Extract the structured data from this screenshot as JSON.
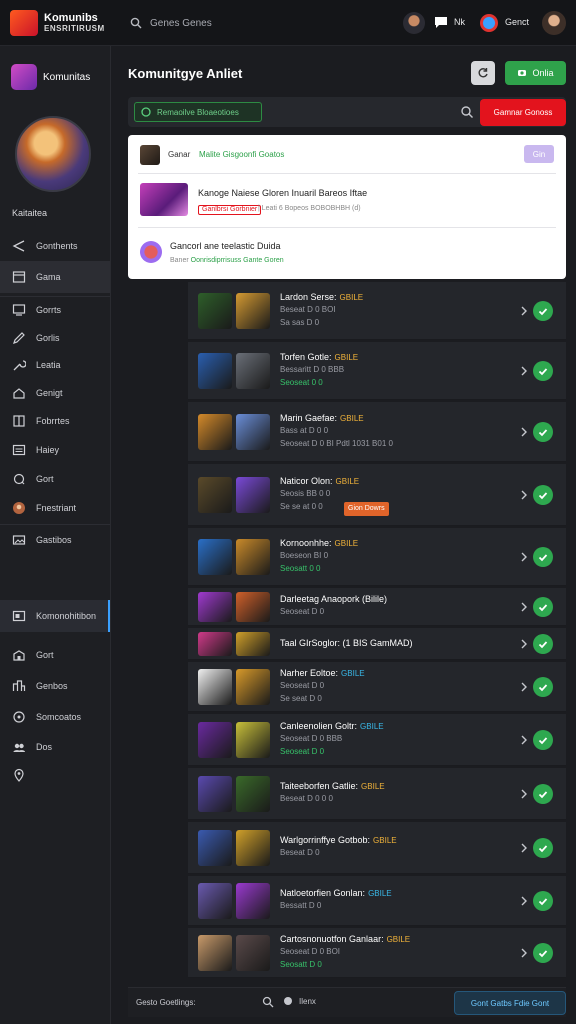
{
  "app": {
    "logo_line1": "Komunibs",
    "logo_line2": "ENSRITIRUSM",
    "search_placeholder": "Genes Genes",
    "top_user1": "Nk",
    "top_user2": "Genct"
  },
  "sidebar": {
    "brand": "Komunitas",
    "username": "Kaitaitea",
    "items": [
      {
        "label": "Gonthents",
        "icon": "share-icon"
      },
      {
        "label": "Gama",
        "icon": "window-icon"
      },
      {
        "label": "Gorrts",
        "icon": "monitor-icon"
      },
      {
        "label": "Gorlis",
        "icon": "pencil-icon"
      },
      {
        "label": "Leatia",
        "icon": "wrench-icon"
      },
      {
        "label": "Genigt",
        "icon": "home-icon"
      },
      {
        "label": "Fobrrtes",
        "icon": "book-icon"
      },
      {
        "label": "Haiey",
        "icon": "list-icon"
      },
      {
        "label": "Gort",
        "icon": "chat-icon"
      },
      {
        "label": "Fnestriant",
        "icon": "avatar-icon"
      },
      {
        "label": "Gastibos",
        "icon": "gallery-icon"
      },
      {
        "label": "Komonohitibon",
        "icon": "media-icon"
      },
      {
        "label": "Gort",
        "icon": "building-icon"
      },
      {
        "label": "Genbos",
        "icon": "city-icon"
      },
      {
        "label": "Somcoatos",
        "icon": "clock-icon"
      },
      {
        "label": "Dos",
        "icon": "people-icon"
      },
      {
        "label": "",
        "icon": "pin-icon"
      }
    ]
  },
  "header": {
    "title": "Komunitgye Anliet",
    "online_label": "Onlia"
  },
  "search": {
    "chip_label": "Remaoilve Bloaeotioes",
    "button_label": "Gamnar Gonoss"
  },
  "panel": {
    "row1_label": "Ganar",
    "row1_highlight": "Malite Gisgoonfi Goatos",
    "row1_badge": "Gin",
    "row2_title": "Kanoge Naiese Gloren Inuaril Bareos Iftae",
    "row2_tag": "Ganlbrsi Gorbnier",
    "row2_meta": "| Leati 6 Bopeos BOBOBHBH (d)",
    "row3_title": "Gancorl ane teelastic Duida",
    "row3_meta_prefix": "Baner",
    "row3_meta_green": "Oonrisdiprrisuss Gante Goren"
  },
  "rows": [
    {
      "title": "Lardon Serse:",
      "tag": "GBILE",
      "tag_color": "orange",
      "line2": "Beseat D 0 BOI",
      "line3": "Sa sas D 0",
      "line3_green": false
    },
    {
      "title": "Torfen Gotle:",
      "tag": "GBILE",
      "tag_color": "orange",
      "line2": "Bessaritt D 0 BBB",
      "line3": "Seoseat 0 0",
      "line3_green": true
    },
    {
      "title": "Marin Gaefae:",
      "tag": "GBILE",
      "tag_color": "orange",
      "line2": "Bass at D 0 0",
      "line3": "Seoseat D 0 BI Pdtl 1031 B01 0",
      "line3_green": false
    },
    {
      "title": "Naticor Olon:",
      "tag": "GBILE",
      "tag_color": "orange",
      "line2": "Seosis BB 0 0",
      "line3": "Se se at 0 0",
      "line3_green": false,
      "orange_tag": "Gion Dowrs"
    },
    {
      "title": "Kornoonhhe:",
      "tag": "GBILE",
      "tag_color": "orange",
      "line2": "Boeseon BI 0",
      "line3": "Seosatt 0 0",
      "line3_green": true
    },
    {
      "title": "Darleetag Anaopork (Bilile)",
      "tag": "",
      "tag_color": "orange",
      "line2": "Seoseat D 0",
      "line3": "",
      "line3_green": false
    },
    {
      "title": "Taal GIrSoglor: (1 BIS GamMAD)",
      "tag": "",
      "tag_color": "orange",
      "line2": "",
      "line3": "",
      "line3_green": false
    },
    {
      "title": "Narher Eoltoe:",
      "tag": "GBILE",
      "tag_color": "blue",
      "line2": "Seoseat D 0",
      "line3": "Se seat D 0",
      "line3_green": false
    },
    {
      "title": "Canleenolien Goltr:",
      "tag": "GBILE",
      "tag_color": "blue",
      "line2": "Seoseat D 0 BBB",
      "line3": "Seoseat D 0",
      "line3_green": true
    },
    {
      "title": "Taiteeborfen Gatlie:",
      "tag": "GBILE",
      "tag_color": "orange",
      "line2": "Beseat D 0 0 0",
      "line3": "",
      "line3_green": false
    },
    {
      "title": "Warlgorrinffye Gotbob:",
      "tag": "GBILE",
      "tag_color": "orange",
      "line2": "Beseat D 0",
      "line3": "",
      "line3_green": false
    },
    {
      "title": "Natloetorfien Gonlan:",
      "tag": "GBILE",
      "tag_color": "blue",
      "line2": "Bessatt D 0",
      "line3": "",
      "line3_green": false
    },
    {
      "title": "Cartosnonuotfon Ganlaar:",
      "tag": "GBILE",
      "tag_color": "orange",
      "line2": "Seoseat D 0 BOI",
      "line3": "Seosatt D 0",
      "line3_green": true
    }
  ],
  "bottom": {
    "text": "Gesto Goetlings:",
    "chip": "Ilenx",
    "button": "Gont Gatbs Fdie Gont"
  }
}
